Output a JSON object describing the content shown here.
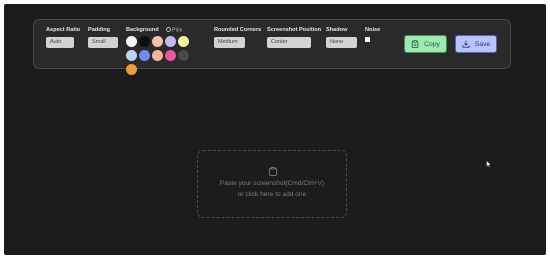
{
  "toolbar": {
    "aspect_ratio": {
      "label": "Aspect Ratio",
      "value": "Auto"
    },
    "padding": {
      "label": "Padding",
      "value": "Small"
    },
    "background": {
      "label": "Background",
      "pick_label": "Pick",
      "swatches": [
        "#f5f5f5",
        "#0e0e0e",
        "#f4c3a8",
        "#c7b8ee",
        "#f2f1a0",
        "#b8d6f4",
        "#6f8ef0",
        "#f6b59b",
        "#e956a4",
        "#4a4a4a",
        "#f09a3a"
      ]
    },
    "rounded_corners": {
      "label": "Rounded Corners",
      "value": "Medium"
    },
    "screenshot_position": {
      "label": "Screenshot Position",
      "value": "Center"
    },
    "shadow": {
      "label": "Shadow",
      "value": "None"
    },
    "noise": {
      "label": "Noise"
    },
    "copy_label": "Copy",
    "save_label": "Save"
  },
  "dropzone": {
    "line1": "Paste your screenshot(Cmd/Ctrl+V)",
    "line2": "or click here to add one",
    "icon": "clipboard-icon"
  },
  "colors": {
    "app_bg": "#1c1c1c",
    "toolbar_bg": "#2a2a2a",
    "copy_bg": "#9ee9b2",
    "save_bg": "#b8c3ff"
  }
}
